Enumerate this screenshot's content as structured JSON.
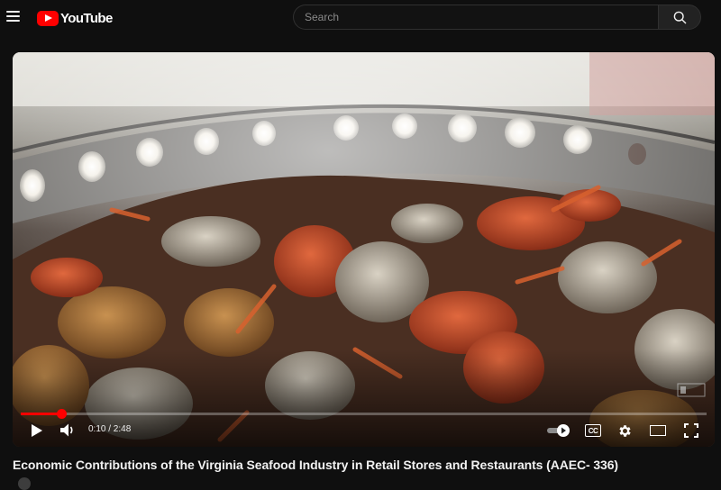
{
  "header": {
    "logo_text": "YouTube",
    "search_placeholder": "Search",
    "brand_color": "#ff0000"
  },
  "player": {
    "current_time": "0:10",
    "duration": "2:48",
    "time_text": "0:10 / 2:48",
    "progress_fraction": 0.0595,
    "controls": [
      "play-icon",
      "volume-icon",
      "autoplay-toggle",
      "subtitles-icon",
      "settings-icon",
      "theater-icon",
      "fullscreen-icon"
    ],
    "captions_label": "CC"
  },
  "video": {
    "title": "Economic Contributions of the Virginia Seafood Industry in Retail Stores and Restaurants (AAEC- 336)"
  }
}
